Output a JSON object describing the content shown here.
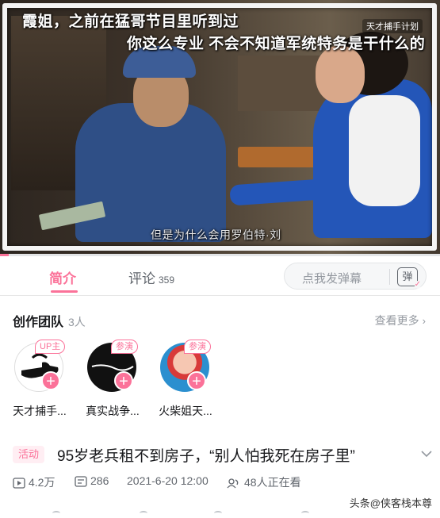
{
  "video": {
    "subtitle_line1": "霞姐，之前在猛哥节目里听到过",
    "subtitle_line2": "你这么专业 不会不知道军统特务是干什么的",
    "subtitle_line3": "但是为什么会用罗伯特·刘",
    "corner_watermark": "天才捕手计划",
    "progress": 0.02
  },
  "tabs": {
    "intro_label": "简介",
    "comments_label": "评论",
    "comments_count": "359"
  },
  "danmaku": {
    "placeholder": "点我发弹幕",
    "button_label": "弹"
  },
  "team": {
    "heading": "创作团队",
    "count": "3人",
    "more_label": "查看更多",
    "members": [
      {
        "badge": "UP主",
        "name": "天才捕手...",
        "avatar_icon": "hand-gesture-icon"
      },
      {
        "badge": "参演",
        "name": "真实战争...",
        "avatar_icon": "dark-avatar-icon"
      },
      {
        "badge": "参演",
        "name": "火柴姐天...",
        "avatar_icon": "cartoon-girl-icon"
      }
    ]
  },
  "video_info": {
    "tag": "活动",
    "title": "95岁老兵租不到房子，“别人怕我死在房子里”",
    "views": "4.2万",
    "danmaku_count": "286",
    "date": "2021-6-20 12:00",
    "watching": "48人正在看"
  },
  "footer": {
    "watermark": "头条@侠客栈本尊"
  },
  "colors": {
    "accent": "#fb7299",
    "text_primary": "#18191c",
    "text_secondary": "#61666d",
    "text_muted": "#9499a0"
  }
}
